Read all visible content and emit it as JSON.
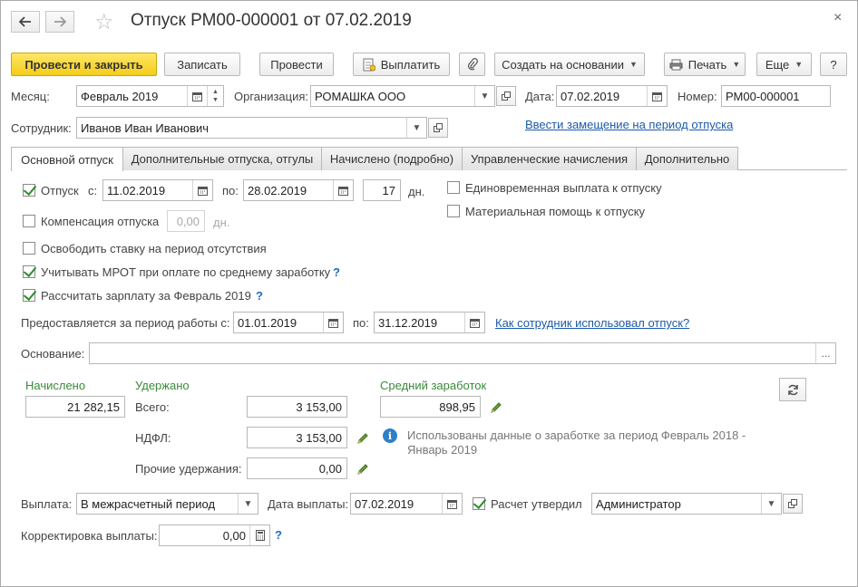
{
  "window": {
    "title": "Отпуск РМ00-000001 от 07.02.2019",
    "close": "×"
  },
  "toolbar": {
    "post_close": "Провести и закрыть",
    "save": "Записать",
    "post": "Провести",
    "pay": "Выплатить",
    "create_based": "Создать на основании",
    "print": "Печать",
    "more": "Еще",
    "help": "?"
  },
  "header": {
    "month_label": "Месяц:",
    "month_value": "Февраль 2019",
    "org_label": "Организация:",
    "org_value": "РОМАШКА ООО",
    "date_label": "Дата:",
    "date_value": "07.02.2019",
    "number_label": "Номер:",
    "number_value": "РМ00-000001",
    "employee_label": "Сотрудник:",
    "employee_value": "Иванов Иван Иванович",
    "replacement_link": "Ввести замещение на период отпуска"
  },
  "tabs": [
    {
      "label": "Основной отпуск",
      "active": true
    },
    {
      "label": "Дополнительные отпуска, отгулы",
      "active": false
    },
    {
      "label": "Начислено (подробно)",
      "active": false
    },
    {
      "label": "Управленческие начисления",
      "active": false
    },
    {
      "label": "Дополнительно",
      "active": false
    }
  ],
  "main": {
    "vacation_label": "Отпуск",
    "vacation_checked": true,
    "from_label": "с:",
    "from_value": "11.02.2019",
    "to_label": "по:",
    "to_value": "28.02.2019",
    "days_value": "17",
    "days_label": "дн.",
    "lump_sum_label": "Единовременная выплата к отпуску",
    "lump_sum_checked": false,
    "material_aid_label": "Материальная помощь к отпуску",
    "material_aid_checked": false,
    "compensation_label": "Компенсация отпуска",
    "compensation_checked": false,
    "compensation_value": "0,00",
    "compensation_unit": "дн.",
    "free_rate_label": "Освободить ставку на период отсутствия",
    "free_rate_checked": false,
    "mrot_label": "Учитывать МРОТ при оплате по среднему заработку",
    "mrot_checked": true,
    "calc_salary_label": "Рассчитать зарплату за Февраль 2019",
    "calc_salary_checked": true,
    "help_mark": "?",
    "period_label": "Предоставляется за период работы с:",
    "period_from": "01.01.2019",
    "period_to_label": "по:",
    "period_to": "31.12.2019",
    "usage_link": "Как сотрудник использовал отпуск?",
    "basis_label": "Основание:",
    "basis_value": "",
    "basis_btn": "..."
  },
  "amounts": {
    "accrued_label": "Начислено",
    "accrued_value": "21 282,15",
    "withheld_label": "Удержано",
    "total_label": "Всего:",
    "total_value": "3 153,00",
    "ndfl_label": "НДФЛ:",
    "ndfl_value": "3 153,00",
    "other_label": "Прочие удержания:",
    "other_value": "0,00",
    "avg_label": "Средний заработок",
    "avg_value": "898,95",
    "info_text": "Использованы данные о заработке за период Февраль 2018 - Январь 2019"
  },
  "footer": {
    "payout_label": "Выплата:",
    "payout_value": "В межрасчетный период",
    "pay_date_label": "Дата выплаты:",
    "pay_date_value": "07.02.2019",
    "approved_label": "Расчет утвердил",
    "approved_checked": true,
    "approver_value": "Администратор",
    "correction_label": "Корректировка выплаты:",
    "correction_value": "0,00"
  },
  "colors": {
    "primary_button": "#f4cc1a",
    "link": "#1d5aa8",
    "section_green": "#3a8a3a"
  }
}
